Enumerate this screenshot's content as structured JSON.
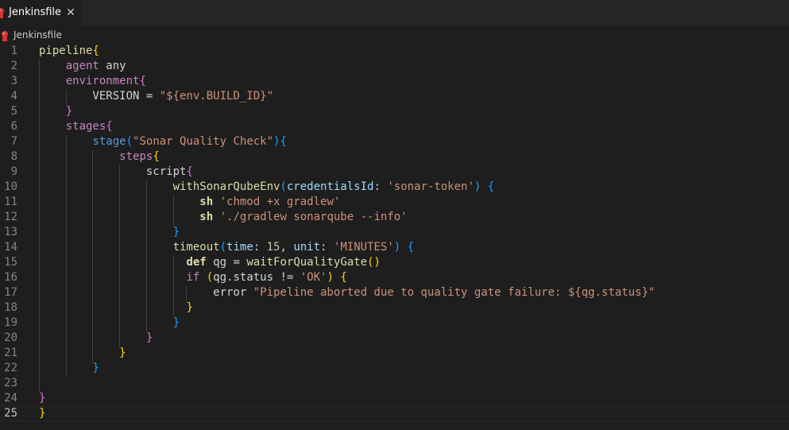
{
  "tab": {
    "title": "Jenkinsfile",
    "close_glyph": "✕"
  },
  "breadcrumb": {
    "label": "Jenkinsfile"
  },
  "icons": {
    "file": "jenkins-file-icon",
    "close": "close-icon"
  },
  "colors": {
    "background": "#1e1e1e",
    "tab_bar": "#252526",
    "keyword": "#c586c0",
    "function": "#dcdcaa",
    "string": "#ce9178",
    "number": "#b5cea8",
    "parameter": "#9cdcfe",
    "bracket_1": "#ffd700",
    "bracket_2": "#da70d6",
    "bracket_3": "#179fff"
  },
  "editor": {
    "current_line": 25,
    "lines": [
      {
        "n": "1",
        "tokens": [
          [
            "fn",
            "pipeline"
          ],
          [
            "b1",
            "{"
          ]
        ]
      },
      {
        "n": "2",
        "tokens": [
          [
            "id",
            "    "
          ],
          [
            "kw",
            "agent"
          ],
          [
            "id",
            " any"
          ]
        ]
      },
      {
        "n": "3",
        "tokens": [
          [
            "id",
            "    "
          ],
          [
            "kw",
            "environment"
          ],
          [
            "b2",
            "{"
          ]
        ]
      },
      {
        "n": "4",
        "tokens": [
          [
            "id",
            "        VERSION = "
          ],
          [
            "str",
            "\"${env.BUILD_ID}\""
          ]
        ]
      },
      {
        "n": "5",
        "tokens": [
          [
            "id",
            "    "
          ],
          [
            "b2",
            "}"
          ]
        ]
      },
      {
        "n": "6",
        "tokens": [
          [
            "id",
            "    "
          ],
          [
            "kw",
            "stages"
          ],
          [
            "b2",
            "{"
          ]
        ]
      },
      {
        "n": "7",
        "tokens": [
          [
            "id",
            "        "
          ],
          [
            "blue",
            "stage"
          ],
          [
            "b3",
            "("
          ],
          [
            "str",
            "\"Sonar Quality Check\""
          ],
          [
            "b3",
            ")"
          ],
          [
            "b3",
            "{"
          ]
        ]
      },
      {
        "n": "8",
        "tokens": [
          [
            "id",
            "            "
          ],
          [
            "kw",
            "steps"
          ],
          [
            "b1",
            "{"
          ]
        ]
      },
      {
        "n": "9",
        "tokens": [
          [
            "id",
            "                script"
          ],
          [
            "b2",
            "{"
          ]
        ]
      },
      {
        "n": "10",
        "tokens": [
          [
            "id",
            "                    "
          ],
          [
            "fn",
            "withSonarQubeEnv"
          ],
          [
            "b3",
            "("
          ],
          [
            "param",
            "credentialsId"
          ],
          [
            "id",
            ": "
          ],
          [
            "str",
            "'sonar-token'"
          ],
          [
            "b3",
            ")"
          ],
          [
            "id",
            " "
          ],
          [
            "b3",
            "{"
          ]
        ]
      },
      {
        "n": "11",
        "tokens": [
          [
            "id",
            "                        "
          ],
          [
            "fn bold",
            "sh"
          ],
          [
            "id",
            " "
          ],
          [
            "str",
            "'chmod +x gradlew'"
          ]
        ]
      },
      {
        "n": "12",
        "tokens": [
          [
            "id",
            "                        "
          ],
          [
            "fn bold",
            "sh"
          ],
          [
            "id",
            " "
          ],
          [
            "str",
            "'./gradlew sonarqube --info'"
          ]
        ]
      },
      {
        "n": "13",
        "tokens": [
          [
            "id",
            "                    "
          ],
          [
            "b3",
            "}"
          ]
        ]
      },
      {
        "n": "14",
        "tokens": [
          [
            "id",
            "                    "
          ],
          [
            "fn",
            "timeout"
          ],
          [
            "b3",
            "("
          ],
          [
            "param",
            "time"
          ],
          [
            "id",
            ": "
          ],
          [
            "num",
            "15"
          ],
          [
            "id",
            ", "
          ],
          [
            "param",
            "unit"
          ],
          [
            "id",
            ": "
          ],
          [
            "str",
            "'MINUTES'"
          ],
          [
            "b3",
            ")"
          ],
          [
            "id",
            " "
          ],
          [
            "b3",
            "{"
          ]
        ]
      },
      {
        "n": "15",
        "tokens": [
          [
            "id",
            "                      "
          ],
          [
            "fn bold",
            "def"
          ],
          [
            "id",
            " qg = "
          ],
          [
            "fn",
            "waitForQualityGate"
          ],
          [
            "b1",
            "()"
          ]
        ]
      },
      {
        "n": "16",
        "tokens": [
          [
            "id",
            "                      "
          ],
          [
            "kw",
            "if"
          ],
          [
            "id",
            " "
          ],
          [
            "b1",
            "("
          ],
          [
            "id",
            "qg.status != "
          ],
          [
            "str",
            "'OK'"
          ],
          [
            "b1",
            ")"
          ],
          [
            "id",
            " "
          ],
          [
            "b1",
            "{"
          ]
        ]
      },
      {
        "n": "17",
        "tokens": [
          [
            "id",
            "                          error "
          ],
          [
            "str",
            "\"Pipeline aborted due to quality gate failure: ${qg.status}\""
          ]
        ]
      },
      {
        "n": "18",
        "tokens": [
          [
            "id",
            "                      "
          ],
          [
            "b1",
            "}"
          ]
        ]
      },
      {
        "n": "19",
        "tokens": [
          [
            "id",
            "                    "
          ],
          [
            "b3",
            "}"
          ]
        ]
      },
      {
        "n": "20",
        "tokens": [
          [
            "id",
            "                "
          ],
          [
            "b2",
            "}"
          ]
        ]
      },
      {
        "n": "21",
        "tokens": [
          [
            "id",
            "            "
          ],
          [
            "b1",
            "}"
          ]
        ]
      },
      {
        "n": "22",
        "tokens": [
          [
            "id",
            "        "
          ],
          [
            "b3",
            "}"
          ]
        ]
      },
      {
        "n": "23",
        "tokens": []
      },
      {
        "n": "24",
        "tokens": [
          [
            "b2",
            "}"
          ]
        ]
      },
      {
        "n": "25",
        "tokens": [
          [
            "b1",
            "}"
          ]
        ]
      }
    ]
  }
}
